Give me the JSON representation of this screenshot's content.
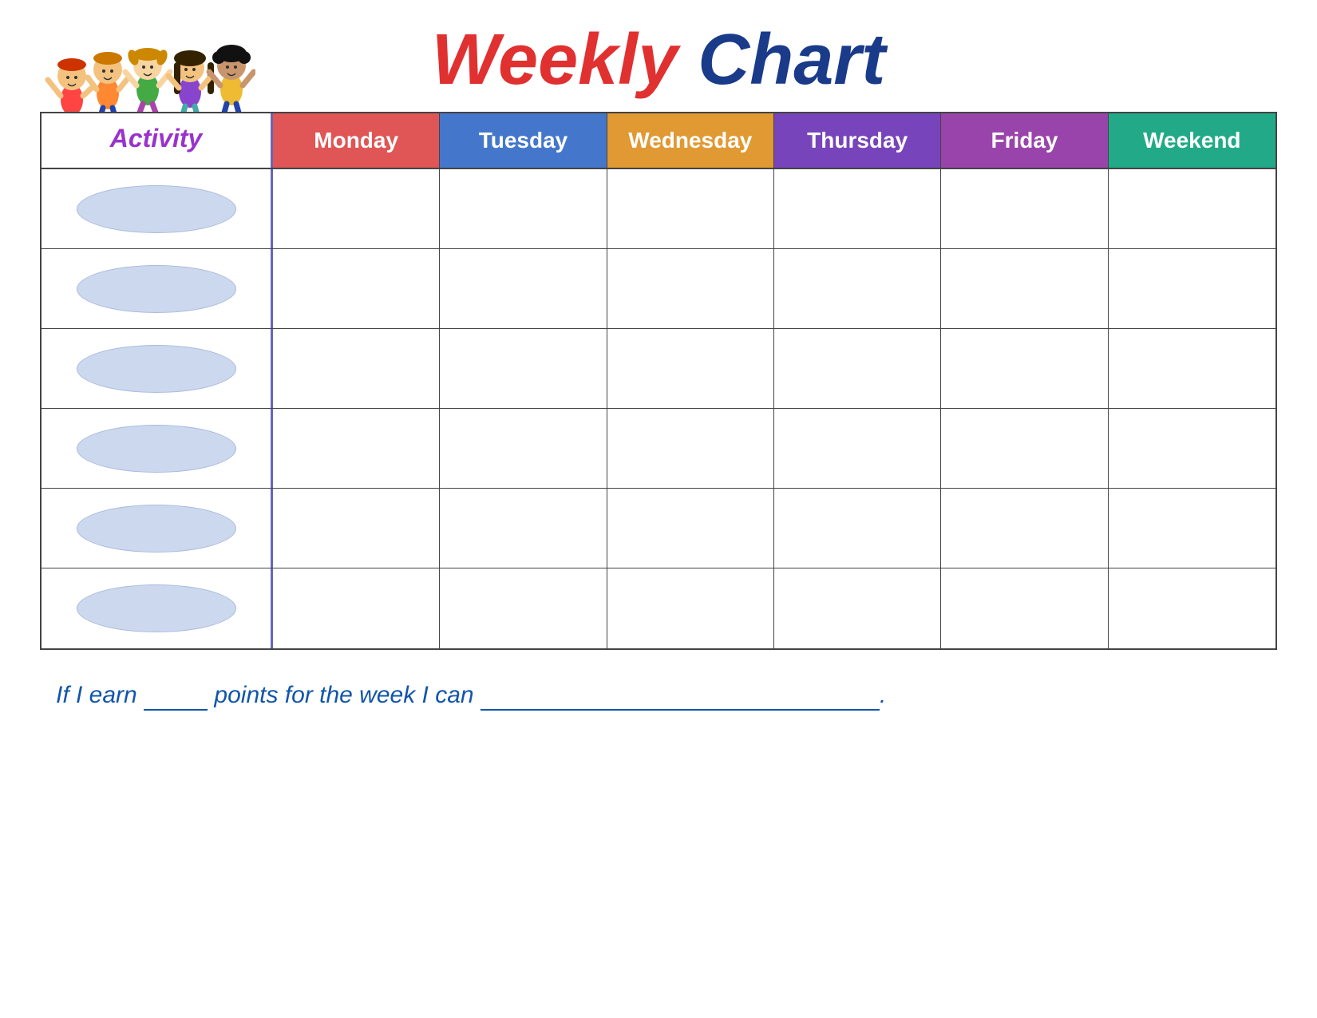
{
  "title": {
    "weekly": "Weekly",
    "chart": "Chart"
  },
  "activity_label": "Activity",
  "days": [
    {
      "label": "Monday",
      "class": "day-monday"
    },
    {
      "label": "Tuesday",
      "class": "day-tuesday"
    },
    {
      "label": "Wednesday",
      "class": "day-wednesday"
    },
    {
      "label": "Thursday",
      "class": "day-thursday"
    },
    {
      "label": "Friday",
      "class": "day-friday"
    },
    {
      "label": "Weekend",
      "class": "day-weekend"
    }
  ],
  "rows": [
    {
      "id": 1
    },
    {
      "id": 2
    },
    {
      "id": 3
    },
    {
      "id": 4
    },
    {
      "id": 5
    },
    {
      "id": 6
    }
  ],
  "footer": {
    "part1": "If I earn",
    "blank1": "_____",
    "part2": "points for the week I can",
    "blank2": "",
    "period": "."
  }
}
